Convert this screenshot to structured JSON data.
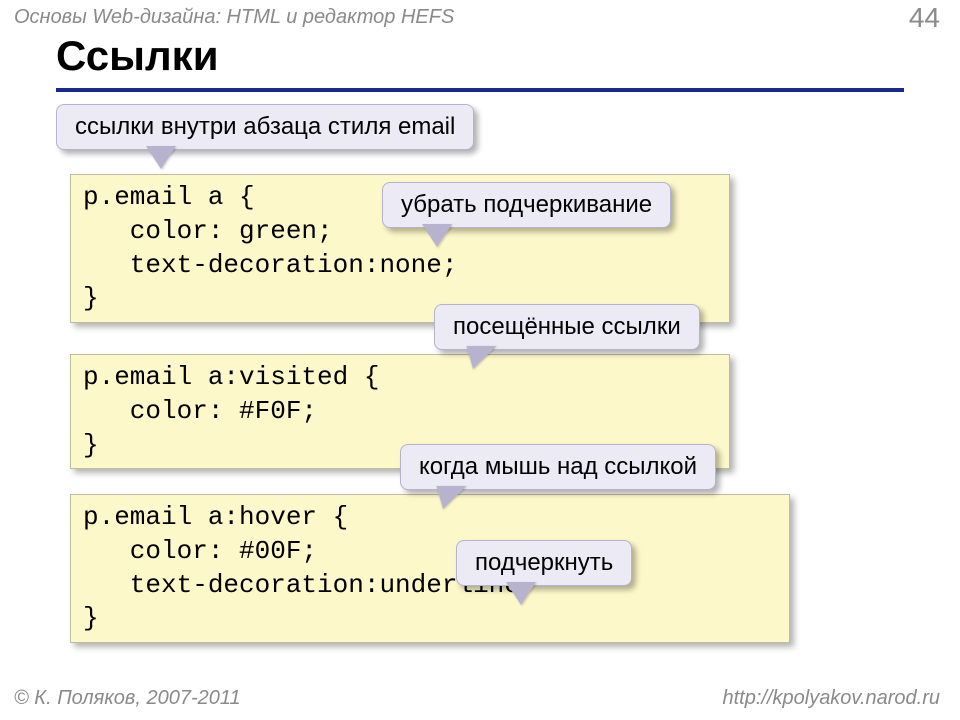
{
  "header": {
    "course": "Основы Web-дизайна: HTML и редактор HEFS",
    "page_number": "44"
  },
  "title": "Ссылки",
  "callouts": {
    "c1": "ссылки внутри абзаца стиля email",
    "c2": "убрать подчеркивание",
    "c3": "посещённые ссылки",
    "c4": "когда мышь над ссылкой",
    "c5": "подчеркнуть"
  },
  "code": {
    "box1": "p.email a {\n   color: green;\n   text-decoration:none;\n}",
    "box2": "p.email a:visited {\n   color: #F0F;\n}",
    "box3": "p.email a:hover {\n   color: #00F;\n   text-decoration:underline;\n}"
  },
  "footer": {
    "copyright": "© К. Поляков, 2007-2011",
    "url": "http://kpolyakov.narod.ru"
  }
}
